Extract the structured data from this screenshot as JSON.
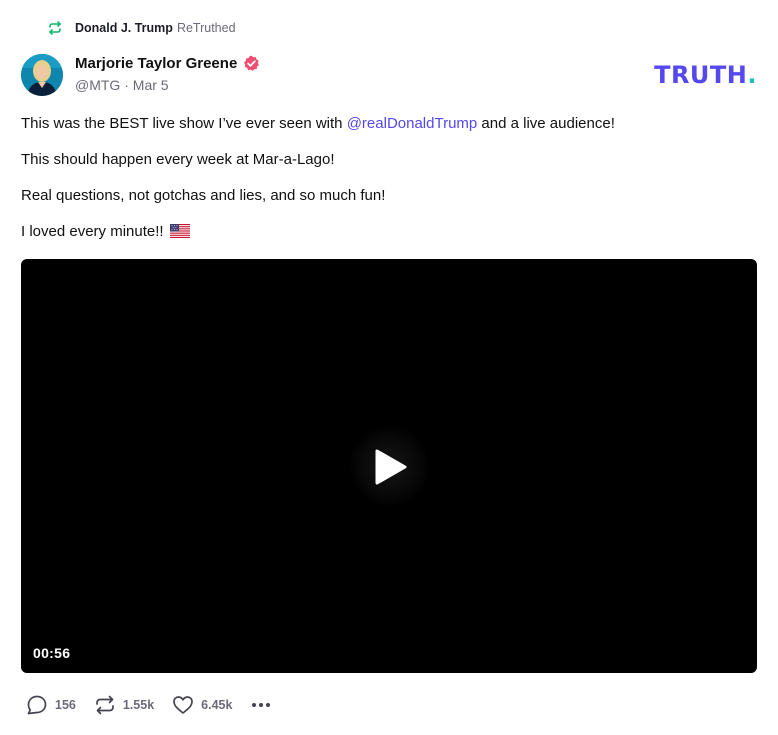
{
  "retruth": {
    "icon": "retruth-icon",
    "name": "Donald J. Trump",
    "verb": "ReTruthed"
  },
  "author": {
    "name": "Marjorie Taylor Greene",
    "handle": "@MTG",
    "separator": "·",
    "date": "Mar 5",
    "verified_icon": "verified-badge-icon"
  },
  "brand": {
    "logo_text": "TRUTH",
    "logo_dot": ".",
    "primary_color": "#5448ee",
    "accent_color": "#17c3b2"
  },
  "post": {
    "line1_before": "This was the BEST live show I’ve ever seen with ",
    "line1_mention": "@realDonaldTrump",
    "line1_after": " and a live audience!",
    "line2": "This should happen every week at Mar-a-Lago!",
    "line3": "Real questions, not gotchas and lies, and so much fun!",
    "line4": "I loved every minute!! ",
    "line4_emoji": "us-flag-icon"
  },
  "video": {
    "duration": "00:56",
    "play_icon": "play-icon"
  },
  "actions": {
    "replies": "156",
    "retruths": "1.55k",
    "likes": "6.45k",
    "reply_icon": "reply-icon",
    "retruth_icon": "retruth-icon",
    "like_icon": "heart-icon",
    "more_icon": "more-icon"
  }
}
